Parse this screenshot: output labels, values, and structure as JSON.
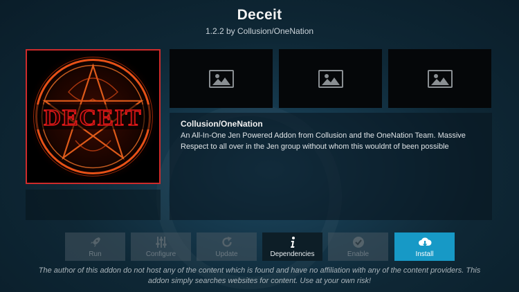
{
  "addon": {
    "title": "Deceit",
    "version_line": "1.2.2 by Collusion/OneNation",
    "icon_text": "DECEIT"
  },
  "screenshots": [
    {
      "icon": "image-placeholder-icon"
    },
    {
      "icon": "image-placeholder-icon"
    },
    {
      "icon": "image-placeholder-icon"
    }
  ],
  "description": {
    "author": "Collusion/OneNation",
    "text": "An All-In-One Jen Powered Addon from Collusion and the OneNation Team. Massive Respect to all over in the Jen group without whom this wouldnt of been possible"
  },
  "buttons": {
    "run": {
      "label": "Run",
      "icon": "rocket-icon",
      "state": "disabled"
    },
    "configure": {
      "label": "Configure",
      "icon": "sliders-icon",
      "state": "disabled"
    },
    "update": {
      "label": "Update",
      "icon": "refresh-icon",
      "state": "disabled"
    },
    "dependencies": {
      "label": "Dependencies",
      "icon": "info-icon",
      "state": "enabled"
    },
    "enable": {
      "label": "Enable",
      "icon": "check-circle-icon",
      "state": "disabled"
    },
    "install": {
      "label": "Install",
      "icon": "cloud-download-icon",
      "state": "focused"
    }
  },
  "disclaimer": "The author of this addon do not host any of the content which is found and have no affiliation with any of the content providers. This addon simply searches websites for content. Use at your own risk!",
  "colors": {
    "focus": "#1799c6",
    "icon_border": "#cf2b2b",
    "fire": "#ff5a1a"
  }
}
